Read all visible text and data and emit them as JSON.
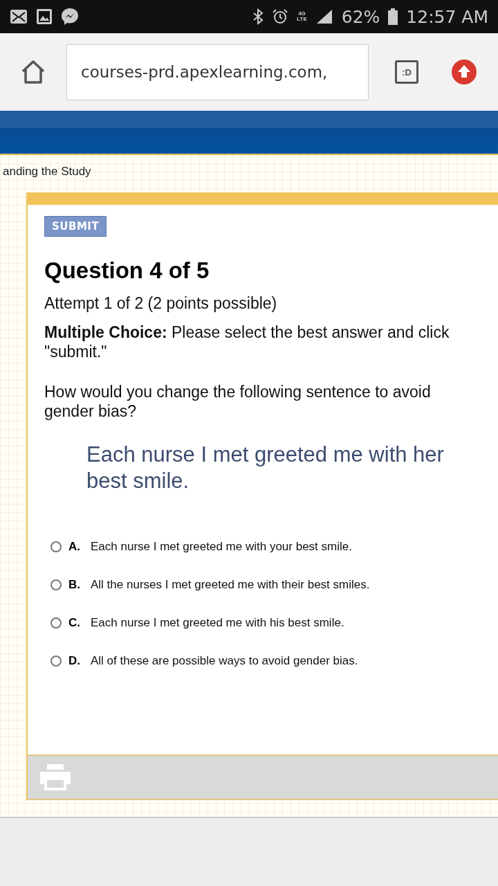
{
  "status_bar": {
    "network_type": [
      "4G",
      "LTE"
    ],
    "battery": "62%",
    "time": "12:57 AM"
  },
  "browser": {
    "url": "courses-prd.apexlearning.com,",
    "tab_badge": ":D"
  },
  "breadcrumb": "anding the Study",
  "question": {
    "submit_label": "SUBMIT",
    "title": "Question 4 of 5",
    "attempt": "Attempt 1 of 2 (2 points possible)",
    "instructions": "**Multiple Choice:** Please select the best answer and click \"submit.\"",
    "prompt": "How would you change the following sentence to avoid gender bias?",
    "sentence": "Each nurse I met greeted me with her best smile.",
    "options": [
      {
        "letter": "A.",
        "text": "Each nurse I met greeted me with your best smile.",
        "selected": false
      },
      {
        "letter": "B.",
        "text": "All the nurses I met greeted me with their best smiles.",
        "selected": false
      },
      {
        "letter": "C.",
        "text": "Each nurse I met greeted me with his best smile.",
        "selected": false
      },
      {
        "letter": "D.",
        "text": "All of these are possible ways to avoid gender bias.",
        "selected": false
      }
    ]
  }
}
